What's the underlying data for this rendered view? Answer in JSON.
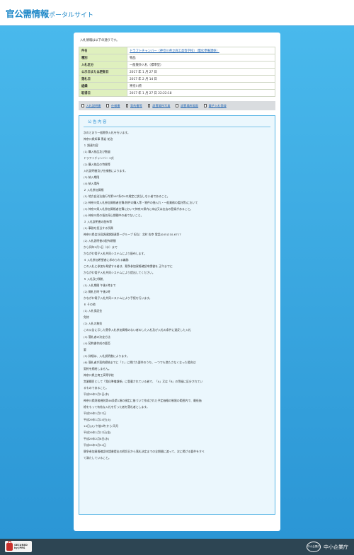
{
  "header": {
    "logo_main": "官公需情報",
    "logo_sub": "ポータルサイト"
  },
  "intro": "入札情報は以下の通りです。",
  "info_rows": [
    {
      "label": "件名",
      "value": "ドラフトチャンバー（神奈川県立商工高等学校）（電化準備課係）",
      "link": true
    },
    {
      "label": "種別",
      "value": "物品",
      "link": false
    },
    {
      "label": "入札区分",
      "value": "一般競争入札（標準型）",
      "link": false
    },
    {
      "label": "公示日または更新日",
      "value": "2017 年 1 月 27 日",
      "link": false
    },
    {
      "label": "落札日",
      "value": "2017 年 2 月 14 日",
      "link": false
    },
    {
      "label": "組織",
      "value": "神奈川県",
      "link": false
    },
    {
      "label": "取得日",
      "value": "2017 年 1 月 27 日 22:22:18",
      "link": false
    }
  ],
  "links": [
    "入札説明書",
    "仕様書",
    "契約書等",
    "設置場所写真",
    "設置場所図面",
    "電子入札登録"
  ],
  "notice": {
    "title": "公告内容",
    "lines": [
      "次のとおり一般競争入札を行います。",
      "神奈川県知事 黒岩 祐治",
      "１ 調達内容",
      "(1) 購入物品及び数量",
      "ドラフトチャンバー 2式",
      "(2) 購入物品の特質等",
      "入札説明書及び仕様書によります。",
      "(3) 納入期限",
      "(4) 納入場所",
      "２ 入札参加資格",
      "(1) 地方自治法施行令第167条の4の規定に該当しない者であること。",
      "(2) 神奈川県入札参加資格者名簿(物件の購入等・物件の借入れ・一般業務の委託等)において",
      "(3) 神奈川県入札参加資格者名簿において神奈川県内に本店又は支店の登録があること。",
      "(4) 神奈川県の指名停止期間中の者でないこと。",
      "３ 入札説明書の配布等",
      "(1) 事務を担当する所属",
      "神奈川県会計局調達課調達第一グループ 担当：北村 佐幸 電話(045)210-6717",
      "(2) 入札説明書の配布期間",
      "から同年2月1日（水）まで",
      "かながわ電子入札共同システムにより配布します。",
      "４ 入札参加希望者に求められる義務",
      "この入札に参加を希望する者は、競争参加資格確認申請書を 正午までに",
      "かながわ電子入札共同システムにより提出してください。",
      "５ 入札及び開札",
      "(1) 入札期間 午後1時まで",
      "(2) 開札日時 午後2時",
      "かながわ電子入札共同システムにより手続を行います。",
      "６ その他",
      "(1) 入札保証金",
      "免除",
      "(2) 入札の無効",
      "この公告に示した競争入札参加資格のない者のした入札及び入札の条件に違反した入札",
      "(3) 落札者の決定方法",
      "(4) 契約書作成の要否",
      "要",
      "(5) 詳細は、入札説明書によります。",
      "(6) 落札者が契約締結までに「２」に掲げた要件のうち、一つでも満たさなくなった場合は",
      "契約を締結しません。",
      "神奈川県立商工高等学校",
      "営業種目として「電化準備課係」に登載されている者で、「A」又は「B」の等級に区分されてい",
      "るものであること。",
      "平成29年2月2日(木)",
      "神奈川県財務規則第46条第1項の規定に基づいて作成された予定価格の制限の範囲内で、最低価",
      "格をもって有効な入札を行った者を落札者とします。",
      "平成29年1月27日",
      "平成29年1月24日(火)",
      "14日(火) 午後1時 から 同月",
      "平成29年1月27日(金)",
      "平成29年2月8日(水)",
      "平成29年3月24日",
      "競争参加資格確認申請書提出の締切日から落札決定までの全期間に渡って、次に掲げる要件をすべ",
      "て満たしていること。"
    ]
  },
  "footer": {
    "secured_line1": "SECURED",
    "secured_line2": "by JPRS",
    "sme_mark": "中小企業庁",
    "sme_text": "中小企業庁"
  }
}
